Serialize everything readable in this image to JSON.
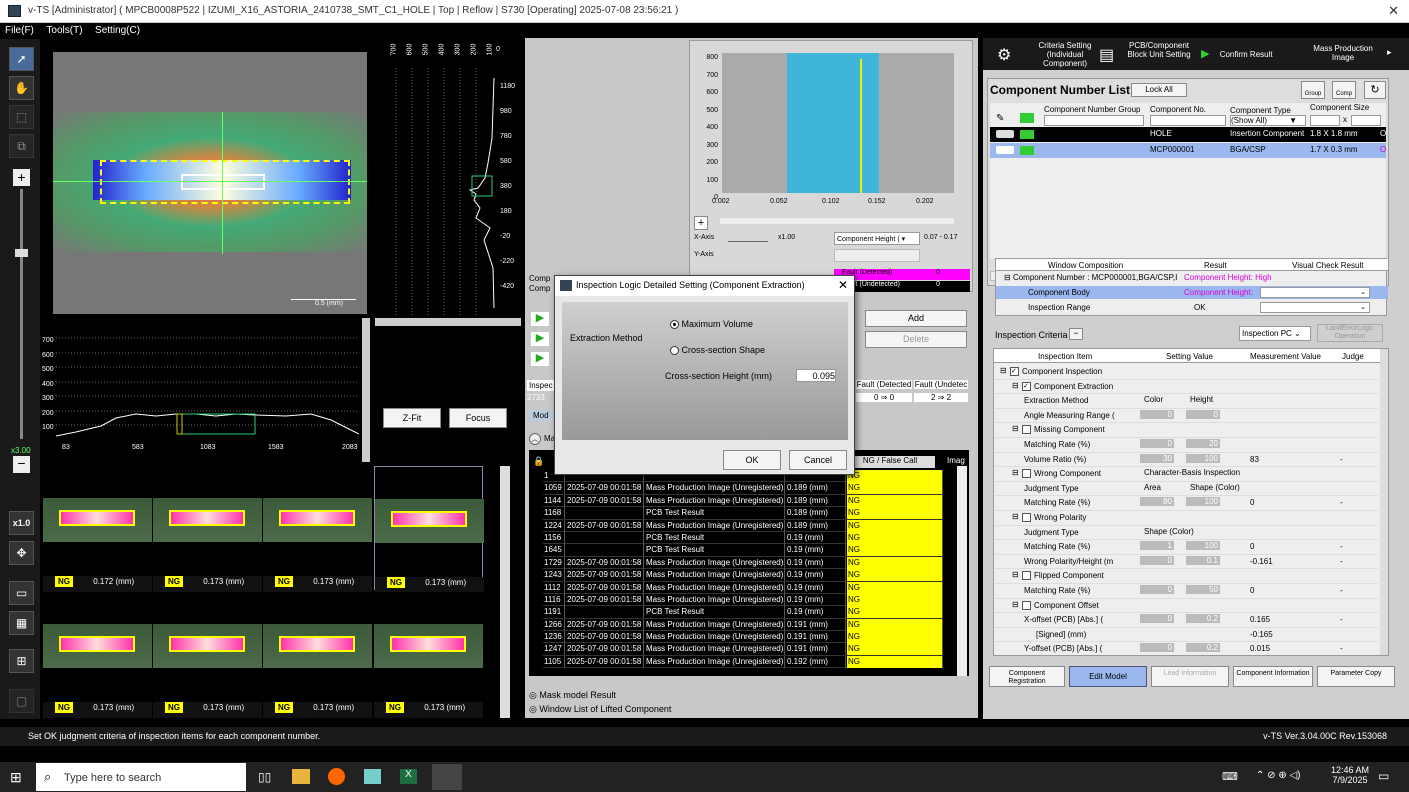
{
  "window": {
    "title": "v-TS [Administrator] ( MPCB0008P522 | IZUMI_X16_ASTORIA_2410738_SMT_C1_HOLE | Top | Reflow | S730 [Operating] 2025-07-08 23:56:21 )",
    "close_glyph": "✕"
  },
  "menu": [
    "File(F)",
    "Tools(T)",
    "Setting(C)"
  ],
  "left_tools": {
    "zoom_label": "x3.00",
    "ratio_label": "x1.0"
  },
  "main_image": {
    "scale_label": "0.5 (mm)"
  },
  "right_profile": {
    "top_ticks": [
      "700",
      "600",
      "500",
      "400",
      "300",
      "200",
      "100",
      "0"
    ],
    "right_ticks": [
      "1180",
      "980",
      "780",
      "580",
      "380",
      "180",
      "-20",
      "-220",
      "-420"
    ]
  },
  "bottom_profile": {
    "y_ticks": [
      "700",
      "600",
      "500",
      "400",
      "300",
      "200",
      "100"
    ],
    "x_ticks": [
      "83",
      "583",
      "1083",
      "1583",
      "2083"
    ]
  },
  "fit_buttons": {
    "zfit": "Z-Fit",
    "focus": "Focus"
  },
  "thumbnails": [
    {
      "badge": "NG",
      "value": "0.172 (mm)"
    },
    {
      "badge": "NG",
      "value": "0.173 (mm)"
    },
    {
      "badge": "NG",
      "value": "0.173 (mm)"
    },
    {
      "badge": "NG",
      "value": "0.173 (mm)"
    },
    {
      "badge": "NG",
      "value": "0.173 (mm)"
    },
    {
      "badge": "NG",
      "value": "0.173 (mm)"
    },
    {
      "badge": "NG",
      "value": "0.173 (mm)"
    },
    {
      "badge": "NG",
      "value": "0.173 (mm)"
    }
  ],
  "histogram": {
    "y_ticks": [
      "800",
      "700",
      "600",
      "500",
      "400",
      "300",
      "200",
      "100",
      "0"
    ],
    "x_ticks": [
      "0.002",
      "0.052",
      "0.102",
      "0.152",
      "0.202"
    ],
    "x_axis_label": "X-Axis",
    "x_axis_value": "x1.00",
    "y_axis_label": "Y-Axis",
    "select_value": "Component Height (",
    "range": "0.07 - 0.17",
    "fault_detected": "Fault (Detected)",
    "fault_detected_val": "0",
    "fault_undetected": "Fault (Undetected)",
    "fault_undetected_val": "0"
  },
  "mid": {
    "add": "Add",
    "delete": "Delete",
    "insp_label": "Inspec",
    "insp_count": "2733",
    "fault_det_hdr": "Fault (Detected",
    "fault_undet_hdr": "Fault (Undetec",
    "fault_det_val": "0 ⇒ 0",
    "fault_undet_val": "2 ⇒ 2",
    "mode_tab": "Mod",
    "comp_label1": "Comp",
    "comp_label2": "Comp",
    "list_col_ng": "NG / False Call",
    "list_col_img": "Imag",
    "mask_model": "Mask model Result",
    "lifted": "Window List of Lifted Component",
    "mask_section": "Mas"
  },
  "result_rows": [
    {
      "id": "1",
      "time": "",
      "type": "",
      "val": "",
      "ng": "NG"
    },
    {
      "id": "1059",
      "time": "2025-07-09 00:01:58",
      "type": "Mass Production Image (Unregistered)",
      "val": "0.189 (mm)",
      "ng": "NG"
    },
    {
      "id": "1144",
      "time": "2025-07-09 00:01:58",
      "type": "Mass Production Image (Unregistered)",
      "val": "0.189 (mm)",
      "ng": "NG"
    },
    {
      "id": "1168",
      "time": "",
      "type": "PCB Test Result",
      "val": "0.189 (mm)",
      "ng": "NG"
    },
    {
      "id": "1224",
      "time": "2025-07-09 00:01:58",
      "type": "Mass Production Image (Unregistered)",
      "val": "0.189 (mm)",
      "ng": "NG"
    },
    {
      "id": "1156",
      "time": "",
      "type": "PCB Test Result",
      "val": "0.19 (mm)",
      "ng": "NG"
    },
    {
      "id": "1645",
      "time": "",
      "type": "PCB Test Result",
      "val": "0.19 (mm)",
      "ng": "NG"
    },
    {
      "id": "1729",
      "time": "2025-07-09 00:01:58",
      "type": "Mass Production Image (Unregistered)",
      "val": "0.19 (mm)",
      "ng": "NG"
    },
    {
      "id": "1243",
      "time": "2025-07-09 00:01:58",
      "type": "Mass Production Image (Unregistered)",
      "val": "0.19 (mm)",
      "ng": "NG"
    },
    {
      "id": "1112",
      "time": "2025-07-09 00:01:58",
      "type": "Mass Production Image (Unregistered)",
      "val": "0.19 (mm)",
      "ng": "NG"
    },
    {
      "id": "1116",
      "time": "2025-07-09 00:01:58",
      "type": "Mass Production Image (Unregistered)",
      "val": "0.19 (mm)",
      "ng": "NG"
    },
    {
      "id": "1191",
      "time": "",
      "type": "PCB Test Result",
      "val": "0.19 (mm)",
      "ng": "NG"
    },
    {
      "id": "1266",
      "time": "2025-07-09 00:01:58",
      "type": "Mass Production Image (Unregistered)",
      "val": "0.191 (mm)",
      "ng": "NG"
    },
    {
      "id": "1236",
      "time": "2025-07-09 00:01:58",
      "type": "Mass Production Image (Unregistered)",
      "val": "0.191 (mm)",
      "ng": "NG"
    },
    {
      "id": "1247",
      "time": "2025-07-09 00:01:58",
      "type": "Mass Production Image (Unregistered)",
      "val": "0.191 (mm)",
      "ng": "NG"
    },
    {
      "id": "1105",
      "time": "2025-07-09 00:01:58",
      "type": "Mass Production Image (Unregistered)",
      "val": "0.192 (mm)",
      "ng": "NG"
    }
  ],
  "dialog": {
    "title": "Inspection Logic Detailed Setting (Component Extraction)",
    "close": "✕",
    "extraction_method": "Extraction Method",
    "opt1": "Maximum Volume",
    "opt2": "Cross-section Shape",
    "cs_height_label": "Cross-section Height (mm)",
    "cs_height_value": "0.095",
    "ok": "OK",
    "cancel": "Cancel"
  },
  "toolbar": {
    "criteria": "Criteria Setting (Individual Component)",
    "pcb_block": "PCB/Component Block Unit Setting",
    "confirm": "Confirm Result",
    "mass_image": "Mass Production Image"
  },
  "comp_list": {
    "title": "Component Number List",
    "lock_all": "Lock All",
    "group_btn": "Group",
    "comp_btn": "Comp",
    "col_group": "Component Number Group",
    "col_no": "Component No.",
    "col_type": "Component Type",
    "col_type_sub": "(Show All)",
    "col_size": "Component Size",
    "size_x": "x",
    "rows": [
      {
        "no": "HOLE",
        "type": "Insertion Component",
        "size": "1.8 X 1.8 mm",
        "extra": "O"
      },
      {
        "no": "MCP000001",
        "type": "BGA/CSP",
        "size": "1.7 X 0.3 mm",
        "extra": "O"
      }
    ]
  },
  "window_comp": {
    "col1": "Window Composition",
    "col2": "Result",
    "col3": "Visual Check Result",
    "row0": "Component Number : MCP000001,BGA/CSP,I",
    "row0_result": "Component Height: High",
    "row1": "Component Body",
    "row1_result": "Component Height:",
    "row2": "Inspection Range",
    "row2_result": "OK"
  },
  "criteria": {
    "label": "Inspection Criteria",
    "pc_select": "Inspection PC",
    "land_btn": "LandErrorLogic Operation",
    "col_item": "Inspection Item",
    "col_set": "Setting Value",
    "col_meas": "Measurement Value",
    "col_judge": "Judge",
    "rows": [
      {
        "item": "Component Inspection",
        "s1": "",
        "s2": "",
        "meas": "",
        "judge": ""
      },
      {
        "item": "Component Extraction",
        "s1": "",
        "s2": "",
        "meas": "",
        "judge": ""
      },
      {
        "item": "Extraction Method",
        "s1": "Color",
        "s2": "Height",
        "meas": "",
        "judge": ""
      },
      {
        "item": "Angle Measuring Range (",
        "s1": "0",
        "s2": "0",
        "meas": "",
        "judge": ""
      },
      {
        "item": "Missing Component",
        "s1": "",
        "s2": "",
        "meas": "",
        "judge": ""
      },
      {
        "item": "Matching Rate (%)",
        "s1": "0",
        "s2": "20",
        "meas": "",
        "judge": ""
      },
      {
        "item": "Volume Ratio (%)",
        "s1": "30",
        "s2": "100",
        "meas": "83",
        "judge": "-"
      },
      {
        "item": "Wrong Component",
        "s1": "Character-Basis Inspection",
        "s2": "",
        "meas": "",
        "judge": ""
      },
      {
        "item": "Judgment Type",
        "s1": "Area",
        "s2": "Shape (Color)",
        "meas": "",
        "judge": ""
      },
      {
        "item": "Matching Rate (%)",
        "s1": "80",
        "s2": "100",
        "meas": "0",
        "judge": "-"
      },
      {
        "item": "Wrong Polarity",
        "s1": "",
        "s2": "",
        "meas": "",
        "judge": ""
      },
      {
        "item": "Judgment Type",
        "s1": "Shape (Color)",
        "s2": "",
        "meas": "",
        "judge": ""
      },
      {
        "item": "Matching Rate (%)",
        "s1": "1",
        "s2": "100",
        "meas": "0",
        "judge": "-"
      },
      {
        "item": "Wrong Polarity/Height (m",
        "s1": "0",
        "s2": "0.1",
        "meas": "-0.161",
        "judge": "-"
      },
      {
        "item": "Flipped Component",
        "s1": "",
        "s2": "",
        "meas": "",
        "judge": ""
      },
      {
        "item": "Matching Rate (%)",
        "s1": "0",
        "s2": "50",
        "meas": "0",
        "judge": "-"
      },
      {
        "item": "Component Offset",
        "s1": "",
        "s2": "",
        "meas": "",
        "judge": ""
      },
      {
        "item": "X-offset (PCB) [Abs.] (",
        "s1": "0",
        "s2": "0.2",
        "meas": "0.165",
        "judge": "-"
      },
      {
        "item": "[Signed] (mm)",
        "s1": "",
        "s2": "",
        "meas": "-0.165",
        "judge": ""
      },
      {
        "item": "Y-offset (PCB) [Abs.] (",
        "s1": "0",
        "s2": "0.2",
        "meas": "0.015",
        "judge": "-"
      }
    ]
  },
  "bottom_tabs": [
    "Component Registration",
    "Edit Model",
    "Lead Information",
    "Component Information",
    "Parameter Copy"
  ],
  "status": {
    "message": "Set OK judgment criteria of inspection items for each component number.",
    "version": "v-TS Ver.3.04.00C Rev.153068"
  },
  "taskbar": {
    "search": "Type here to search",
    "time": "12:46 AM",
    "date": "7/9/2025"
  },
  "colors": {
    "ng_yellow": "#ffff00",
    "selected_row": "#9ab8ee",
    "magenta": "#e000e0"
  }
}
